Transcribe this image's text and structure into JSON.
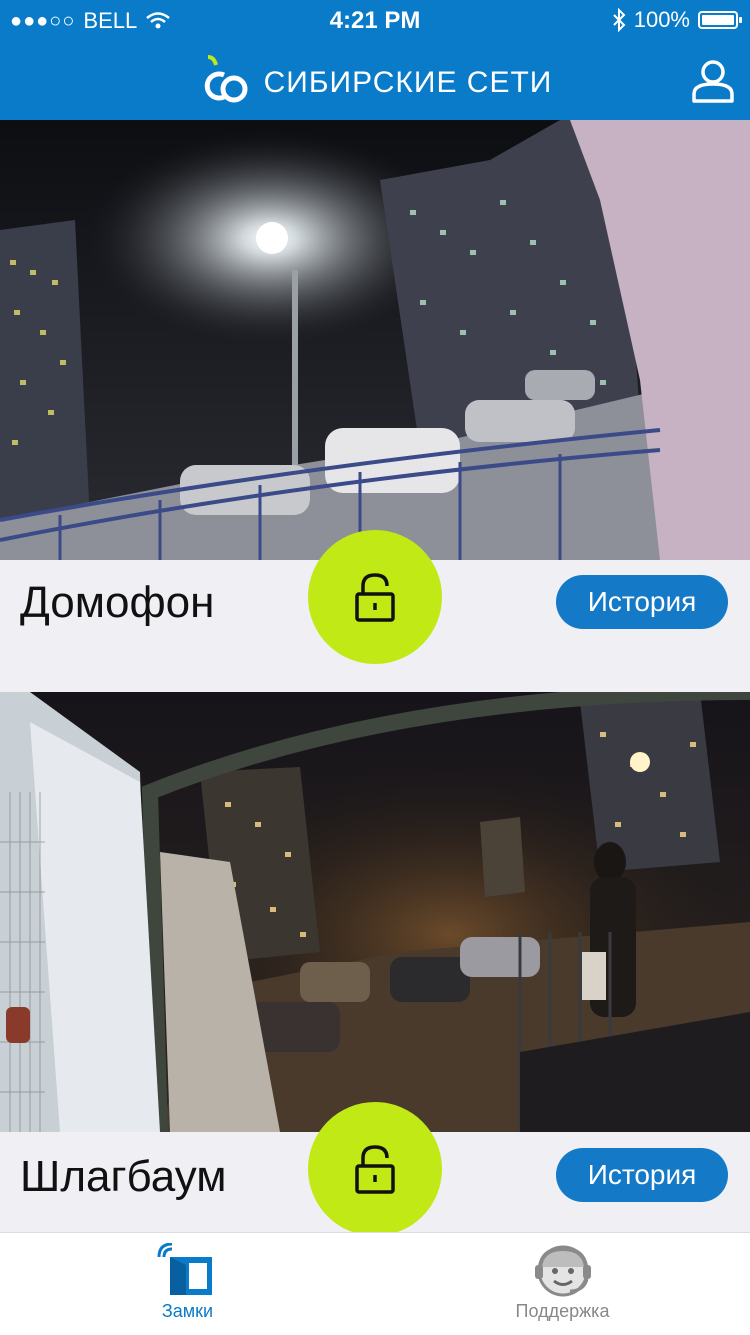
{
  "status_bar": {
    "carrier": "BELL",
    "time": "4:21 PM",
    "battery": "100%"
  },
  "header": {
    "brand": "СИБИРСКИЕ СЕТИ",
    "logo_icon": "brand-logo-icon",
    "profile_icon": "user-profile-icon"
  },
  "locks": [
    {
      "title": "Домофон",
      "history_label": "История",
      "unlock_icon": "unlock-icon"
    },
    {
      "title": "Шлагбаум",
      "history_label": "История",
      "unlock_icon": "unlock-icon"
    }
  ],
  "tabbar": {
    "tabs": [
      {
        "label": "Замки",
        "icon": "locks-door-icon",
        "active": true
      },
      {
        "label": "Поддержка",
        "icon": "support-operator-icon",
        "active": false
      }
    ]
  },
  "colors": {
    "brand_blue": "#0a7bc9",
    "button_blue": "#1479c7",
    "unlock_green": "#c0e916",
    "background": "#efeff4"
  }
}
